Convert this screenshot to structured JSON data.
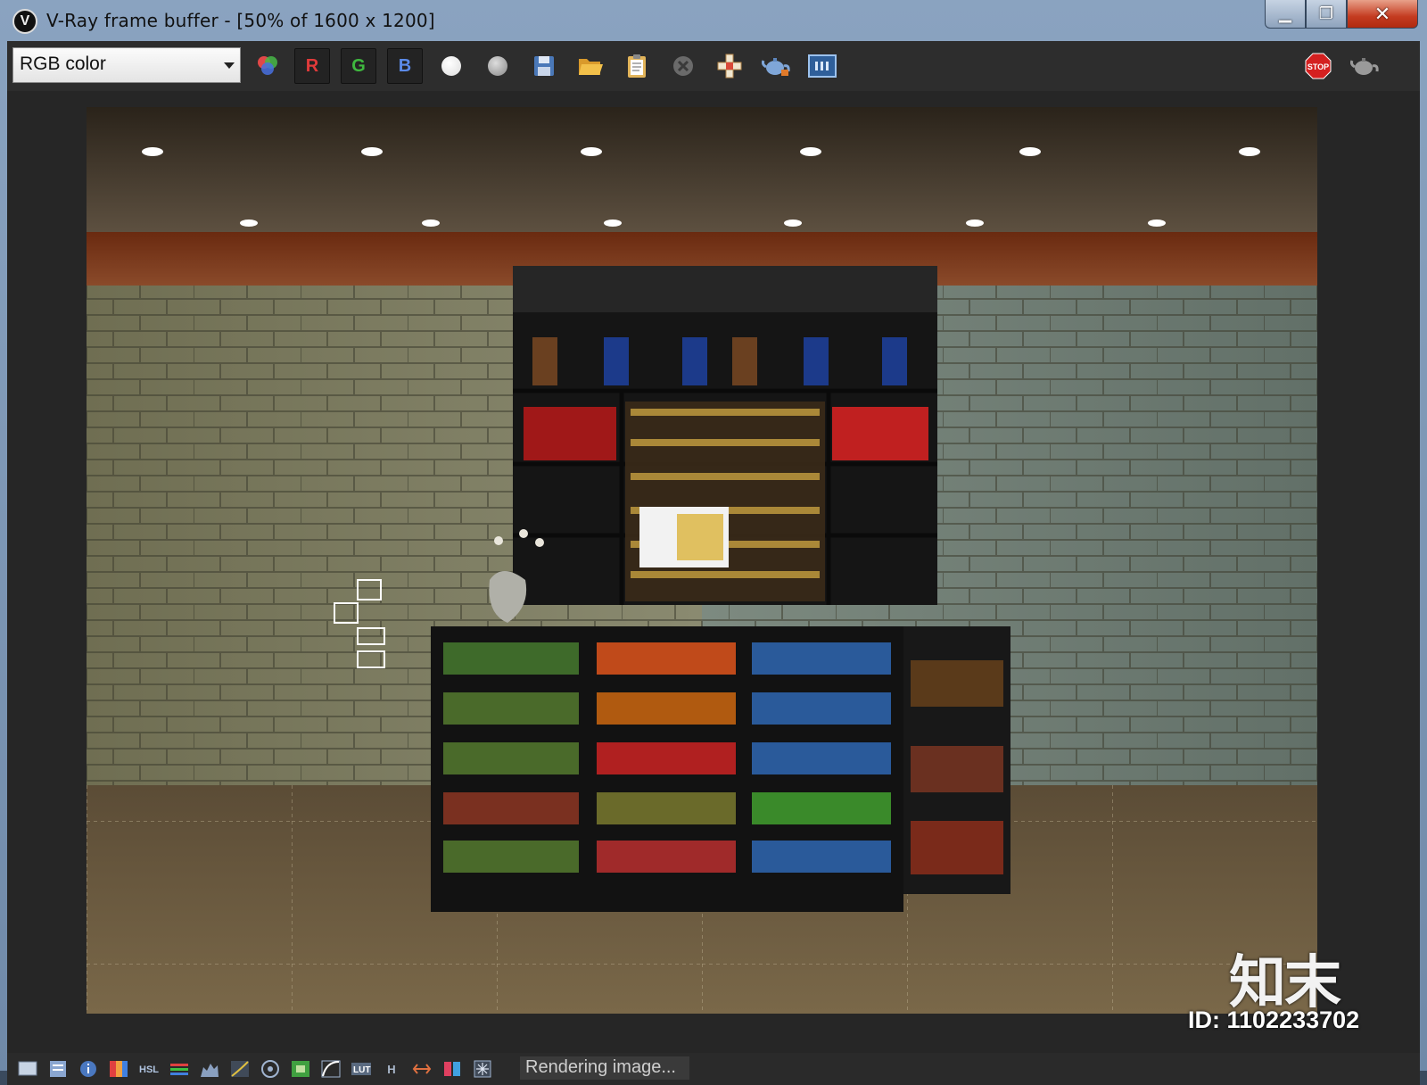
{
  "window": {
    "title": "V-Ray frame buffer - [50% of 1600 x 1200]",
    "app_icon_glyph": "V",
    "minimize_glyph": "▁",
    "maximize_glyph": "❐",
    "close_glyph": "✕"
  },
  "toolbar": {
    "channel_select_value": "RGB color",
    "r_label": "R",
    "g_label": "G",
    "b_label": "B",
    "stop_label": "STOP",
    "icons": [
      "color-wheel-icon",
      "white-circle-icon",
      "gray-circle-icon",
      "save-icon",
      "open-folder-icon",
      "clipboard-icon",
      "clear-icon",
      "region-render-icon",
      "teapot-render-icon",
      "history-icon",
      "stop-icon",
      "teapot-icon"
    ]
  },
  "status": {
    "text": "Rendering image...",
    "corner_label": "H"
  },
  "watermark": {
    "logo_text": "知末",
    "id_text": "ID: 1102233702"
  },
  "colors": {
    "toolbar_bg": "#2d2d2d",
    "viewport_bg": "#262626",
    "stop_red": "#d42020"
  }
}
